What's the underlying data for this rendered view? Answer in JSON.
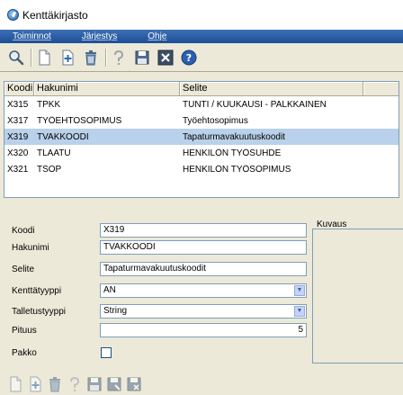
{
  "window": {
    "title": "Kenttäkirjasto"
  },
  "menu": {
    "items": [
      "Toiminnot",
      "Järjestys",
      "Ohje"
    ]
  },
  "toolbar": {
    "buttons": [
      "search-icon",
      "new-document-icon",
      "add-document-icon",
      "delete-icon",
      "undo-icon",
      "save-icon",
      "close-icon",
      "help-icon"
    ]
  },
  "grid": {
    "columns": [
      "Koodi",
      "Hakunimi",
      "Selite",
      ""
    ],
    "rows": [
      {
        "koodi": "X315",
        "hakunimi": "TPKK",
        "selite": "TUNTI / KUUKAUSI - PALKKAINEN"
      },
      {
        "koodi": "X317",
        "hakunimi": "TYÖEHTOSOPIMUS",
        "selite": "Työehtosopimus"
      },
      {
        "koodi": "X319",
        "hakunimi": "TVAKKOODI",
        "selite": "Tapaturmavakuutuskoodit"
      },
      {
        "koodi": "X320",
        "hakunimi": "TLAATU",
        "selite": "HENKILÖN TYÖSUHDE"
      },
      {
        "koodi": "X321",
        "hakunimi": "TSOP",
        "selite": "HENKILÖN TYÖSOPIMUS"
      }
    ],
    "selected_index": 2
  },
  "form": {
    "koodi": {
      "label": "Koodi",
      "value": "X319"
    },
    "hakunimi": {
      "label": "Hakunimi",
      "value": "TVAKKOODI"
    },
    "selite": {
      "label": "Selite",
      "value": "Tapaturmavakuutuskoodit"
    },
    "kenttatyyppi": {
      "label": "Kenttätyyppi",
      "value": "AN"
    },
    "talletustyyppi": {
      "label": "Talletustyyppi",
      "value": "String"
    },
    "pituus": {
      "label": "Pituus",
      "value": "5"
    },
    "pakko": {
      "label": "Pakko",
      "checked": false
    },
    "kuvaus": {
      "label": "Kuvaus"
    }
  },
  "colors": {
    "menubar": "#1d4f98",
    "selected_row": "#b9d1ea",
    "background": "#ece9d8"
  }
}
